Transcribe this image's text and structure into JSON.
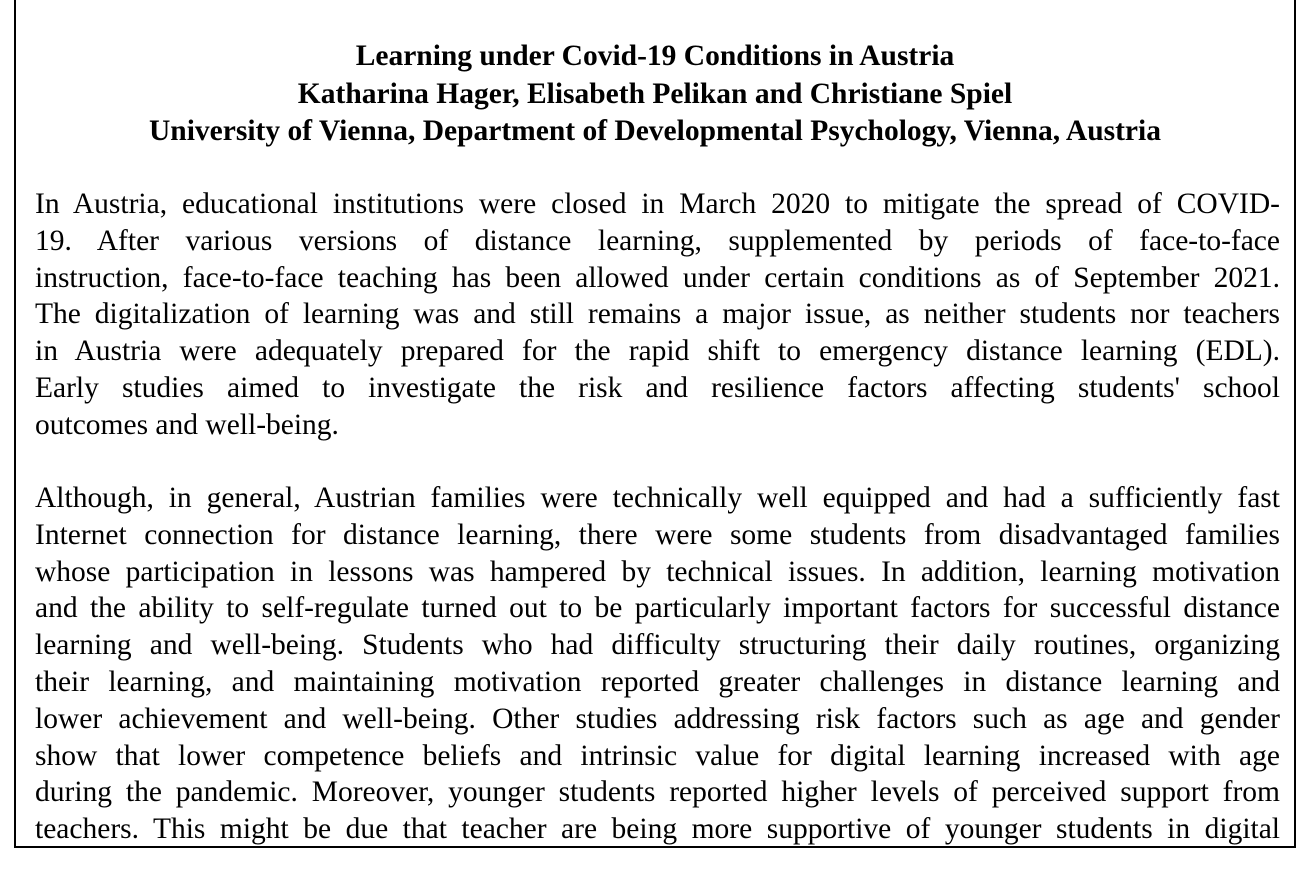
{
  "document": {
    "title": "Learning under Covid-19 Conditions in Austria",
    "authors": "Katharina Hager, Elisabeth Pelikan and Christiane Spiel",
    "affiliation": "University of Vienna, Department of Developmental Psychology, Vienna, Austria",
    "paragraphs": [
      {
        "lines": [
          "In Austria, educational institutions were closed in March 2020 to mitigate the spread of COVID-",
          "19. After various versions of distance learning, supplemented by periods of face-to-face",
          "instruction, face-to-face teaching has been allowed under certain conditions as of September 2021.",
          "The digitalization of learning was and still remains a major issue, as neither students nor teachers",
          "in Austria were adequately prepared for the rapid shift to emergency distance learning (EDL).",
          "Early studies aimed to investigate the risk and resilience factors affecting students' school",
          "outcomes and well-being."
        ]
      },
      {
        "lines": [
          "Although, in general, Austrian families were technically well equipped and had a sufficiently fast",
          "Internet connection for distance learning, there were some students from disadvantaged families",
          "whose participation in lessons was hampered by technical issues. In addition, learning motivation",
          "and the ability to self-regulate turned out to be particularly important factors for successful distance",
          "learning and well-being. Students who had difficulty structuring their daily routines, organizing",
          "their learning, and maintaining motivation reported greater challenges in distance learning and",
          "lower achievement and well-being. Other studies addressing risk factors such as age and gender",
          "show that lower competence beliefs and intrinsic value for digital learning increased with age",
          "during the pandemic. Moreover, younger students reported higher levels of perceived support from",
          "teachers. This might be due that teacher are being more supportive of younger students in digital"
        ]
      }
    ]
  }
}
